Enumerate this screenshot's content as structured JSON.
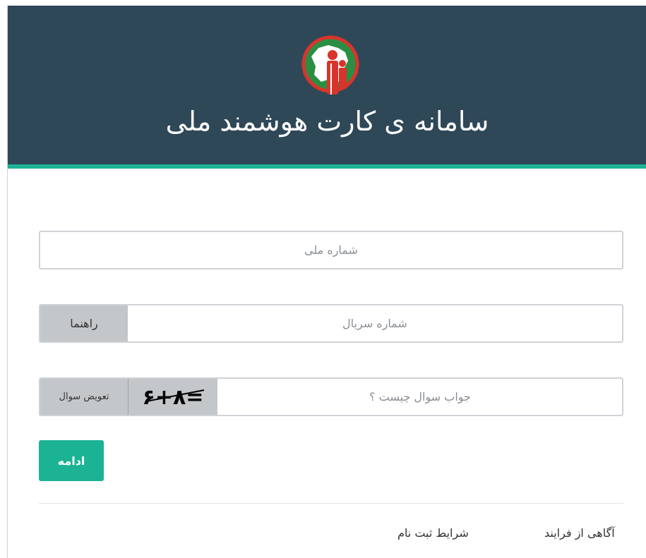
{
  "header": {
    "title": "سامانه ی کارت هوشمند ملی",
    "logo_icon": "iran-map-family-logo-icon",
    "background_color": "#2f4858",
    "accent_color": "#1bb394"
  },
  "form": {
    "national_id": {
      "placeholder": "شماره ملی",
      "value": ""
    },
    "serial": {
      "placeholder": "شماره سریال",
      "value": "",
      "help_label": "راهنما"
    },
    "captcha": {
      "placeholder": "جواب سوال چیست ؟",
      "value": "",
      "challenge_text": "۶+۸=",
      "refresh_label": "تعویض سوال"
    },
    "submit_label": "ادامه"
  },
  "footer": {
    "process_link": "آگاهی از فرایند",
    "terms_link": "شرایط ثبت نام"
  }
}
